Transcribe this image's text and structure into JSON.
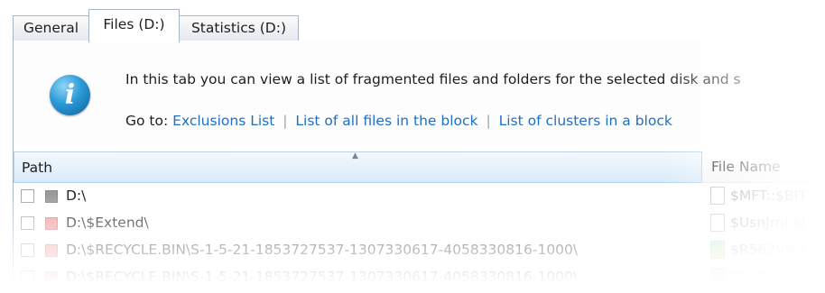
{
  "tabs": [
    {
      "label": "General"
    },
    {
      "label": "Files (D:)",
      "active": true
    },
    {
      "label": "Statistics (D:)"
    }
  ],
  "info": {
    "icon": "info-icon",
    "message": "In this tab you can view a list of fragmented files and folders for the selected disk and s",
    "goto_label": "Go to:",
    "links": [
      {
        "label": "Exclusions List"
      },
      {
        "label": "List of all files in the block"
      },
      {
        "label": "List of clusters in a block"
      }
    ],
    "separator": "|"
  },
  "table": {
    "columns": [
      {
        "label": "Path",
        "sorted": "ascending"
      },
      {
        "label": "File Name"
      }
    ],
    "sort_arrow": "▲",
    "rows": [
      {
        "path": "D:\\",
        "file": "$MFT::$BIT",
        "status_color": "#9a9a9a",
        "file_icon": "document-icon"
      },
      {
        "path": "D:\\$Extend\\",
        "file": "$UsnJrnl:$J",
        "status_color": "#f19aa0",
        "file_icon": "document-icon"
      },
      {
        "path": "D:\\$RECYCLE.BIN\\S-1-5-21-1853727537-1307330617-4058330816-1000\\",
        "file": "$R562VWT",
        "status_color": "#f19aa0",
        "file_icon": "image-file-icon"
      },
      {
        "path": "D:\\$RECYCLE.BIN\\S-1-5-21-1853727537-1307330617-4058330816-1000\\",
        "file": "$R5BA1",
        "status_color": "#f19aa0",
        "file_icon": "image-file-icon"
      }
    ]
  },
  "colors": {
    "link": "#1f6fc5",
    "header_selected": "#d7eaf9",
    "border": "#a9b5c6"
  }
}
